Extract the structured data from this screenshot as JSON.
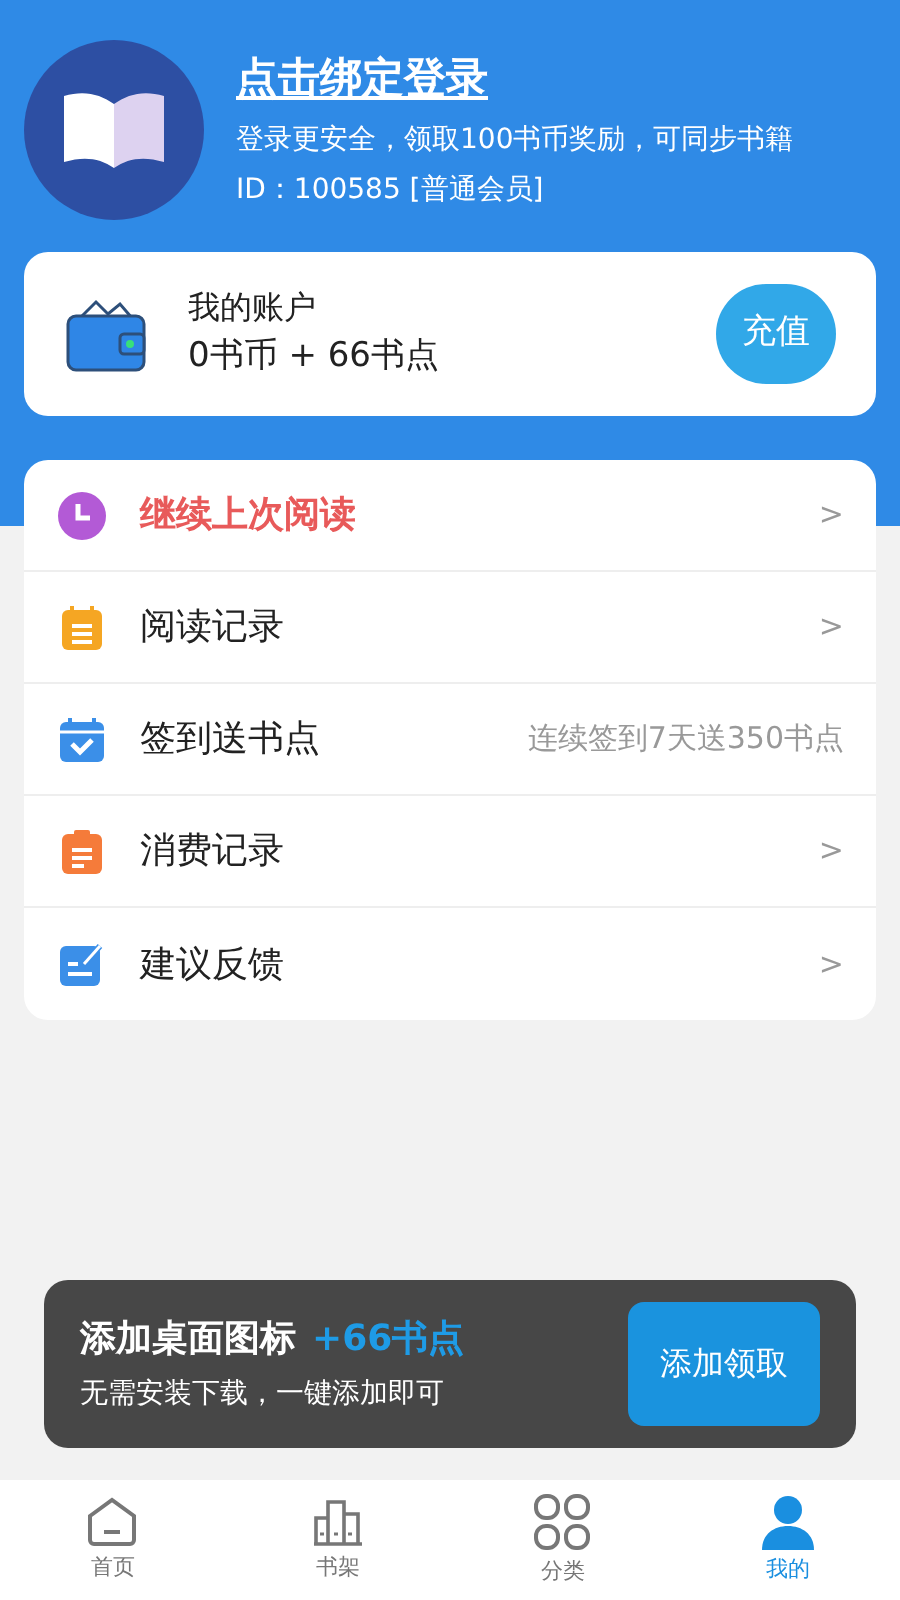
{
  "profile": {
    "title": "点击绑定登录",
    "subtitle": "登录更安全，领取100书币奖励，可同步书籍",
    "id_line": "ID：100585 [普通会员]"
  },
  "account": {
    "title": "我的账户",
    "balance": "0书币 + 66书点",
    "button": "充值"
  },
  "menu": [
    {
      "kind": "clock",
      "label": "继续上次阅读",
      "emphasized": true,
      "trailing": ">"
    },
    {
      "kind": "notepad",
      "label": "阅读记录",
      "emphasized": false,
      "trailing": ">"
    },
    {
      "kind": "calendar",
      "label": "签到送书点",
      "emphasized": false,
      "note": "连续签到7天送350书点"
    },
    {
      "kind": "receipt",
      "label": "消费记录",
      "emphasized": false,
      "trailing": ">"
    },
    {
      "kind": "feedback",
      "label": "建议反馈",
      "emphasized": false,
      "trailing": ">"
    }
  ],
  "banner": {
    "title": "添加桌面图标",
    "bonus": "+66书点",
    "subtitle": "无需安装下载，一键添加即可",
    "button": "添加领取"
  },
  "tabs": [
    {
      "kind": "home",
      "label": "首页",
      "selected": false
    },
    {
      "kind": "shelf",
      "label": "书架",
      "selected": false
    },
    {
      "kind": "grid",
      "label": "分类",
      "selected": false
    },
    {
      "kind": "person",
      "label": "我的",
      "selected": true
    }
  ]
}
